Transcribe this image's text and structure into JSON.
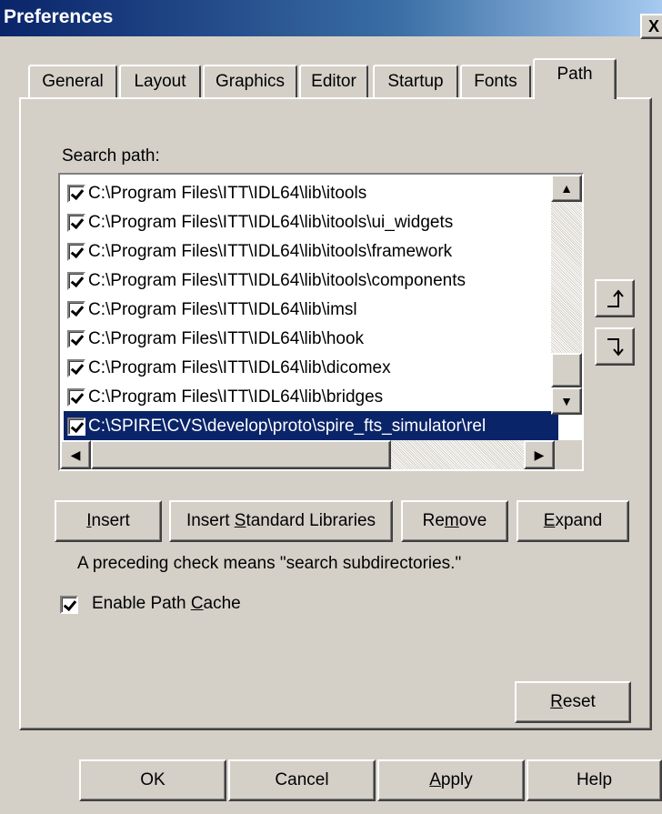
{
  "window": {
    "title": "Preferences",
    "close_label": "X"
  },
  "tabs": [
    {
      "label": "General",
      "active": false
    },
    {
      "label": "Layout",
      "active": false
    },
    {
      "label": "Graphics",
      "active": false
    },
    {
      "label": "Editor",
      "active": false
    },
    {
      "label": "Startup",
      "active": false
    },
    {
      "label": "Fonts",
      "active": false
    },
    {
      "label": "Path",
      "active": true
    }
  ],
  "search_path": {
    "label": "Search path:",
    "items": [
      {
        "path": "C:\\Program Files\\ITT\\IDL64\\lib\\itools",
        "checked": true,
        "selected": false
      },
      {
        "path": "C:\\Program Files\\ITT\\IDL64\\lib\\itools\\ui_widgets",
        "checked": true,
        "selected": false
      },
      {
        "path": "C:\\Program Files\\ITT\\IDL64\\lib\\itools\\framework",
        "checked": true,
        "selected": false
      },
      {
        "path": "C:\\Program Files\\ITT\\IDL64\\lib\\itools\\components",
        "checked": true,
        "selected": false
      },
      {
        "path": "C:\\Program Files\\ITT\\IDL64\\lib\\imsl",
        "checked": true,
        "selected": false
      },
      {
        "path": "C:\\Program Files\\ITT\\IDL64\\lib\\hook",
        "checked": true,
        "selected": false
      },
      {
        "path": "C:\\Program Files\\ITT\\IDL64\\lib\\dicomex",
        "checked": true,
        "selected": false
      },
      {
        "path": "C:\\Program Files\\ITT\\IDL64\\lib\\bridges",
        "checked": true,
        "selected": false
      },
      {
        "path": "C:\\SPIRE\\CVS\\develop\\proto\\spire_fts_simulator\\rel",
        "checked": true,
        "selected": true
      }
    ]
  },
  "move_buttons": {
    "up_icon": "move-up-icon",
    "down_icon": "move-down-icon"
  },
  "actions": {
    "insert": {
      "pre": "",
      "key": "I",
      "post": "nsert"
    },
    "insert_std": {
      "pre": "Insert ",
      "key": "S",
      "post": "tandard Libraries"
    },
    "remove": {
      "pre": "Re",
      "key": "m",
      "post": "ove"
    },
    "expand": {
      "pre": "",
      "key": "E",
      "post": "xpand"
    }
  },
  "hint": "A preceding check means \"search subdirectories.\"",
  "path_cache": {
    "checked": true,
    "label_pre": "Enable Path ",
    "label_key": "C",
    "label_post": "ache"
  },
  "reset": {
    "pre": "",
    "key": "R",
    "post": "eset"
  },
  "footer": {
    "ok": {
      "pre": "OK",
      "key": "",
      "post": ""
    },
    "cancel": {
      "pre": "Cancel",
      "key": "",
      "post": ""
    },
    "apply": {
      "pre": "",
      "key": "A",
      "post": "pply"
    },
    "help": {
      "pre": "Help",
      "key": "",
      "post": ""
    }
  },
  "colors": {
    "face": "#d4d0c8",
    "title_gradient_start": "#0a246a",
    "title_gradient_end": "#a6caf0",
    "selection": "#0a246a"
  }
}
